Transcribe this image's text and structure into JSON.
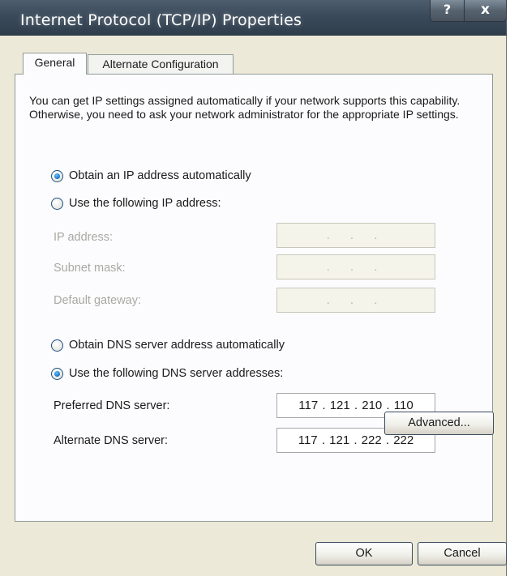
{
  "window": {
    "title": "Internet Protocol (TCP/IP) Properties",
    "help_glyph": "?",
    "close_glyph": "x"
  },
  "tabs": [
    {
      "label": "General",
      "active": true
    },
    {
      "label": "Alternate Configuration",
      "active": false
    }
  ],
  "description": "You can get IP settings assigned automatically if your network supports this capability. Otherwise, you need to ask your network administrator for the appropriate IP settings.",
  "ip_section": {
    "auto_label": "Obtain an IP address automatically",
    "auto_selected": true,
    "manual_label": "Use the following IP address:",
    "manual_selected": false,
    "fields": [
      {
        "label": "IP address:",
        "value": ".    .    .",
        "enabled": false
      },
      {
        "label": "Subnet mask:",
        "value": ".    .    .",
        "enabled": false
      },
      {
        "label": "Default gateway:",
        "value": ".    .    .",
        "enabled": false
      }
    ]
  },
  "dns_section": {
    "auto_label": "Obtain DNS server address automatically",
    "auto_selected": false,
    "manual_label": "Use the following DNS server addresses:",
    "manual_selected": true,
    "fields": [
      {
        "label": "Preferred DNS server:",
        "value": "117 . 121 . 210 . 110",
        "enabled": true
      },
      {
        "label": "Alternate DNS server:",
        "value": "117 . 121 . 222 . 222",
        "enabled": true
      }
    ]
  },
  "buttons": {
    "advanced": "Advanced...",
    "ok": "OK",
    "cancel": "Cancel"
  },
  "colors": {
    "dialog_face": "#ece9d8",
    "panel_bg": "#fcfcfe",
    "titlebar": "#3a4a5a",
    "radio_accent": "#1a6fc4"
  }
}
